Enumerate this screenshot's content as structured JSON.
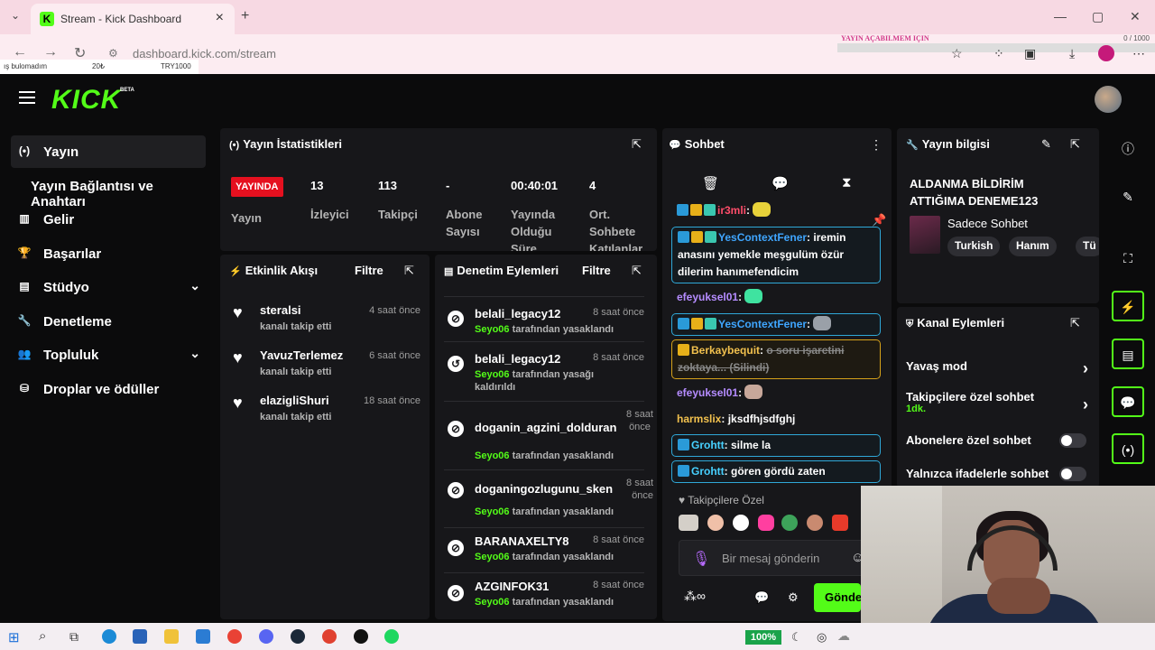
{
  "browser": {
    "tab_title": "Stream - Kick Dashboard",
    "url": "dashboard.kick.com/stream",
    "ticker": [
      "ış bulomadım",
      "20₺",
      "TRY1000"
    ],
    "overlay_title": "YAYIN AÇABILMEM IÇIN",
    "overlay_count": "0 / 1000"
  },
  "header": {
    "logo": "KICK",
    "beta": "BETA"
  },
  "sidebar": {
    "items": [
      {
        "label": "Yayın",
        "icon": "broadcast-icon"
      },
      {
        "label": "Yayın Bağlantısı ve Anahtarı"
      },
      {
        "label": "Gelir",
        "icon": "chart-icon"
      },
      {
        "label": "Başarılar",
        "icon": "trophy-icon"
      },
      {
        "label": "Stüdyo",
        "icon": "studio-icon"
      },
      {
        "label": "Denetleme",
        "icon": "wrench-icon"
      },
      {
        "label": "Topluluk",
        "icon": "community-icon"
      },
      {
        "label": "Droplar ve ödüller",
        "icon": "drops-icon"
      }
    ]
  },
  "stats": {
    "title": "Yayın İstatistikleri",
    "live": "YAYINDA",
    "values": [
      "13",
      "113",
      "-",
      "00:40:01",
      "4"
    ],
    "labels": [
      "Yayın",
      "İzleyici",
      "Takipçi",
      "Abone\nSayısı",
      "Yayında\nOlduğu\nSüre",
      "Ort.\nSohbete\nKatılanlar"
    ]
  },
  "activity": {
    "title": "Etkinlik Akışı",
    "filter": "Filtre",
    "items": [
      {
        "name": "steralsi",
        "sub": "kanalı takip etti",
        "time": "4 saat önce"
      },
      {
        "name": "YavuzTerlemez",
        "sub": "kanalı takip etti",
        "time": "6 saat önce"
      },
      {
        "name": "elazigliShuri",
        "sub": "kanalı takip etti",
        "time": "18 saat önce"
      }
    ]
  },
  "moderation": {
    "title": "Denetim Eylemleri",
    "filter": "Filtre",
    "items": [
      {
        "name": "belali_legacy12",
        "mod": "Seyo06",
        "action": "tarafından yasaklandı",
        "time": "8 saat önce"
      },
      {
        "name": "belali_legacy12",
        "mod": "Seyo06",
        "action": "tarafından yasağı kaldırıldı",
        "time": "8 saat önce"
      },
      {
        "name": "doganin_agzini_dolduran",
        "mod": "Seyo06",
        "action": "tarafından yasaklandı",
        "time": "8 saat önce"
      },
      {
        "name": "doganingozlugunu_sken",
        "mod": "Seyo06",
        "action": "tarafından yasaklandı",
        "time": "8 saat önce"
      },
      {
        "name": "BARANAXELTY8",
        "mod": "Seyo06",
        "action": "tarafından yasaklandı",
        "time": "8 saat önce"
      },
      {
        "name": "AZGINFOK31",
        "mod": "Seyo06",
        "action": "tarafından yasaklandı",
        "time": "8 saat önce"
      }
    ]
  },
  "chat": {
    "title": "Sohbet",
    "messages": [
      {
        "user": "ir3mli",
        "text": ""
      },
      {
        "user": "YesContextFener",
        "text": "iremin anasını yemekle meşgulüm özür dilerim hanımefendicim"
      },
      {
        "user": "efeyuksel01",
        "text": ""
      },
      {
        "user": "YesContextFener",
        "text": ""
      },
      {
        "user": "Berkaybequit",
        "text": "o soru işaretini zoktaya... (Silindi)"
      },
      {
        "user": "efeyuksel01",
        "text": ""
      },
      {
        "user": "harmslix",
        "text": "jksdfhjsdfghj"
      },
      {
        "user": "Grohtt",
        "text": "silme la"
      },
      {
        "user": "Grohtt",
        "text": "gören gördü zaten"
      }
    ],
    "followers_only": "Takipçilere Özel",
    "placeholder": "Bir mesaj gönderin",
    "send": "Gönde"
  },
  "stream_info": {
    "title": "Yayın bilgisi",
    "stream_title": "ALDANMA BİLDİRİM ATTIĞIMA DENEME123",
    "category": "Sadece Sohbet",
    "tags": [
      "Turkish",
      "Hanım",
      "Tü"
    ]
  },
  "channel_actions": {
    "title": "Kanal Eylemleri",
    "slow_mode": "Yavaş mod",
    "followers_chat": "Takipçilere özel sohbet",
    "followers_chat_value": "1dk.",
    "subs_chat": "Abonelere özel sohbet",
    "emotes_chat": "Yalnızca ifadelerle sohbet"
  },
  "taskbar": {
    "battery": "100%"
  },
  "colors": {
    "accent": "#53fc18",
    "live": "#e5101f",
    "panel": "#17171a"
  }
}
